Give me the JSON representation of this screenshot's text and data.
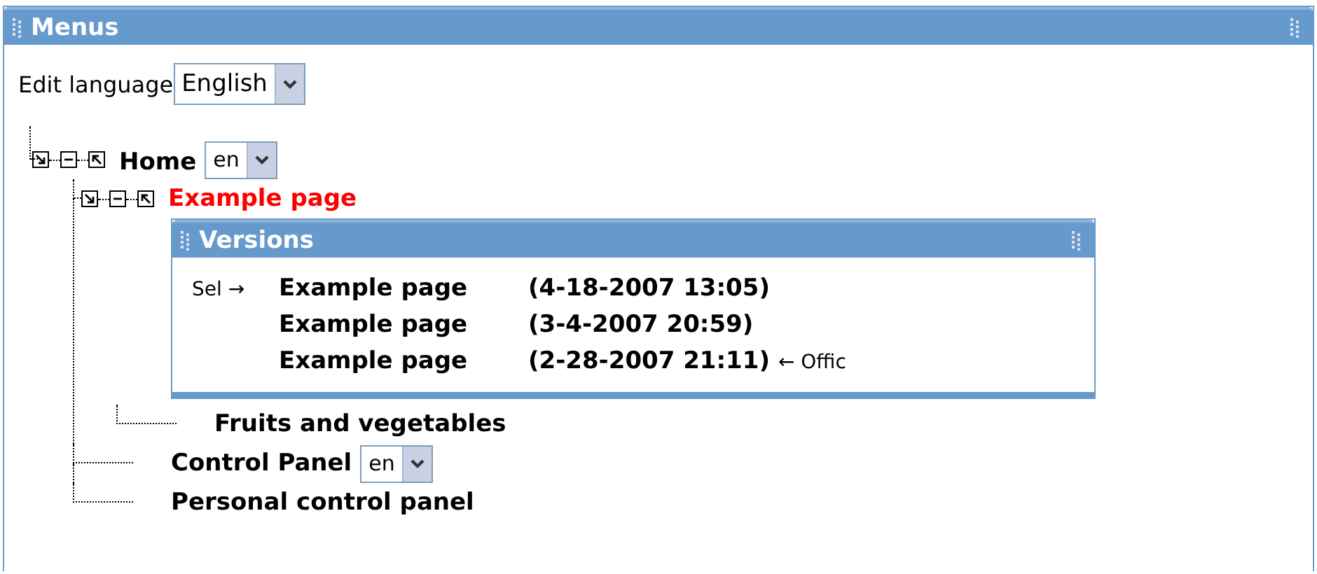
{
  "panel": {
    "title": "Menus"
  },
  "edit_language": {
    "label": "Edit language",
    "value": "English"
  },
  "tree": [
    {
      "label": "Home",
      "current": false,
      "controls": true,
      "language": "en",
      "children": [
        {
          "label": "Example page",
          "current": true,
          "controls": true,
          "versions": {
            "title": "Versions",
            "rows": [
              {
                "marker": "Sel →",
                "name": "Example page",
                "date": "(4-18-2007 13:05)"
              },
              {
                "name": "Example page",
                "date": "(3-4-2007 20:59)"
              },
              {
                "name": "Example page",
                "date": "(2-28-2007 21:11)",
                "note": "← Offic"
              }
            ]
          },
          "children": [
            {
              "label": "Fruits and vegetables",
              "current": false,
              "controls": false
            }
          ]
        },
        {
          "label": "Control Panel",
          "current": false,
          "controls": false,
          "language": "en"
        },
        {
          "label": "Personal control panel",
          "current": false,
          "controls": false
        }
      ]
    }
  ]
}
